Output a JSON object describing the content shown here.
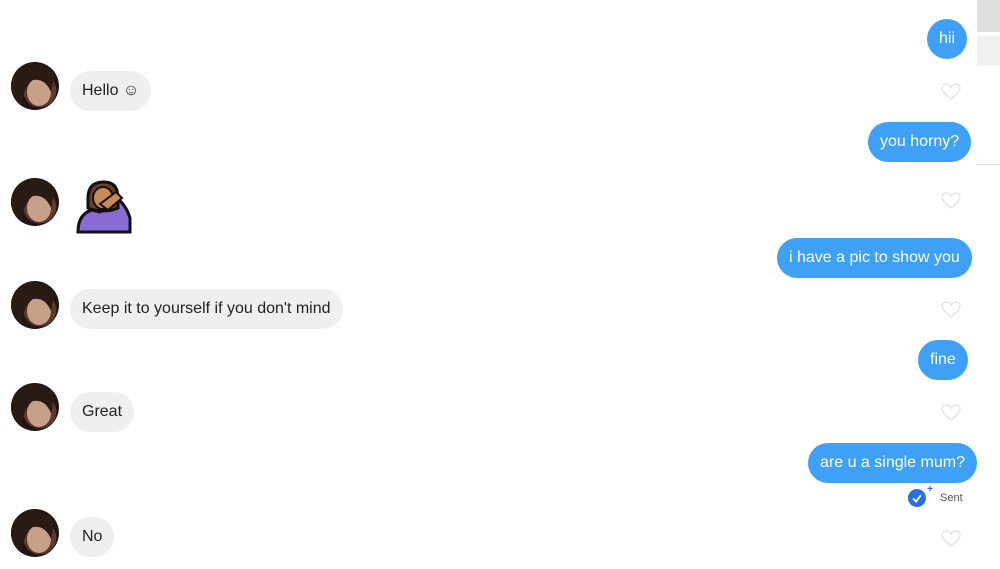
{
  "messages": [
    {
      "id": "m1",
      "dir": "out",
      "text": "hii"
    },
    {
      "id": "m2",
      "dir": "in",
      "text": "Hello ☺"
    },
    {
      "id": "m3",
      "dir": "out",
      "text": "you horny?"
    },
    {
      "id": "m4",
      "dir": "in",
      "type": "sticker",
      "icon": "woman-facepalming-icon"
    },
    {
      "id": "m5",
      "dir": "out",
      "text": "i have a pic to show you"
    },
    {
      "id": "m6",
      "dir": "in",
      "text": "Keep it to yourself if you don't mind"
    },
    {
      "id": "m7",
      "dir": "out",
      "text": "fine"
    },
    {
      "id": "m8",
      "dir": "in",
      "text": "Great"
    },
    {
      "id": "m9",
      "dir": "out",
      "text": "are u a single mum?"
    },
    {
      "id": "m10",
      "dir": "in",
      "text": "No"
    }
  ],
  "status": {
    "label": "Sent",
    "icon": "sent-check-icon"
  },
  "colors": {
    "outgoing": "#3ea0f6",
    "incoming": "#efefef",
    "status_icon": "#2b6fe0"
  }
}
